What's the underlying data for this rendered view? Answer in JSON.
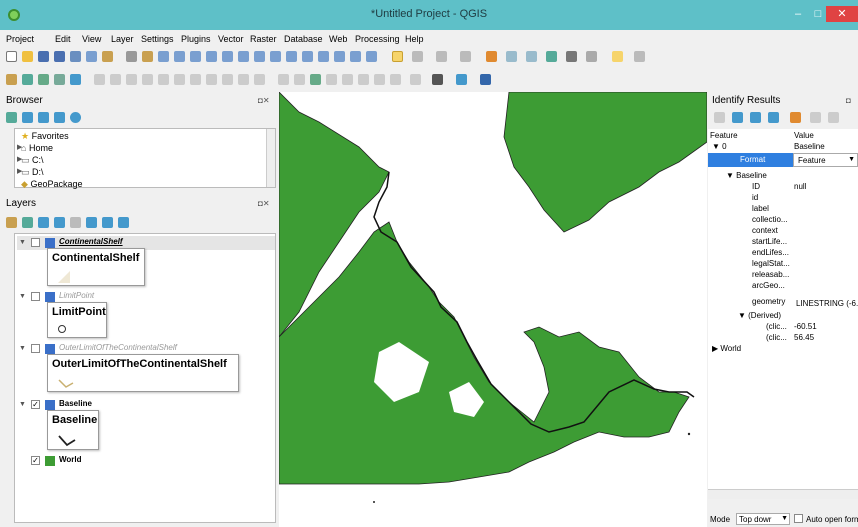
{
  "window": {
    "title": "*Untitled Project - QGIS",
    "min": "–",
    "max": "□",
    "close": "✕"
  },
  "menu": [
    "Project",
    "Edit",
    "View",
    "Layer",
    "Settings",
    "Plugins",
    "Vector",
    "Raster",
    "Database",
    "Web",
    "Processing",
    "Help"
  ],
  "browser": {
    "title": "Browser",
    "items": [
      {
        "label": "Favorites",
        "icon": "star-icon"
      },
      {
        "label": "Home",
        "icon": "home-folder-icon"
      },
      {
        "label": "C:\\",
        "icon": "drive-icon"
      },
      {
        "label": "D:\\",
        "icon": "drive-icon"
      },
      {
        "label": "GeoPackage",
        "icon": "geopackage-icon"
      }
    ]
  },
  "layers": {
    "title": "Layers",
    "items": [
      {
        "name": "ContinentalShelf",
        "legend": "ContinentalShelf",
        "checked": false
      },
      {
        "name": "LimitPoint",
        "legend": "LimitPoint",
        "checked": false
      },
      {
        "name": "OuterLimitOfTheContinentalShelf",
        "legend": "OuterLimitOfTheContinentalShelf",
        "checked": false
      },
      {
        "name": "Baseline",
        "legend": "Baseline",
        "checked": true
      },
      {
        "name": "World",
        "checked": true
      }
    ],
    "check_mark": "✓"
  },
  "identify": {
    "title": "Identify Results",
    "col_feature": "Feature",
    "col_value": "Value",
    "root_index": "0",
    "root_value": "Baseline",
    "format_label": "Format",
    "format_value": "Feature",
    "layer_label": "Baseline",
    "attributes": [
      {
        "name": "ID",
        "value": "null"
      },
      {
        "name": "id",
        "value": ""
      },
      {
        "name": "label",
        "value": ""
      },
      {
        "name": "collectio...",
        "value": ""
      },
      {
        "name": "context",
        "value": ""
      },
      {
        "name": "startLife...",
        "value": ""
      },
      {
        "name": "endLifes...",
        "value": ""
      },
      {
        "name": "legalStat...",
        "value": ""
      },
      {
        "name": "releasab...",
        "value": ""
      },
      {
        "name": "arcGeo...",
        "value": ""
      }
    ],
    "geometry_label": "geometry",
    "geometry_value": "LINESTRING (-6...",
    "derived_label": "(Derived)",
    "derived_rows": [
      {
        "name": "(clic...",
        "value": "-60.51"
      },
      {
        "name": "(clic...",
        "value": "56.45"
      }
    ],
    "world_label": "World",
    "mode_label": "Mode",
    "mode_value": "Top dowr",
    "auto_open_label": "Auto open form"
  },
  "colors": {
    "land": "#3d9c34",
    "selection": "#2f7fe0",
    "title_bar": "#5ec0c8"
  }
}
